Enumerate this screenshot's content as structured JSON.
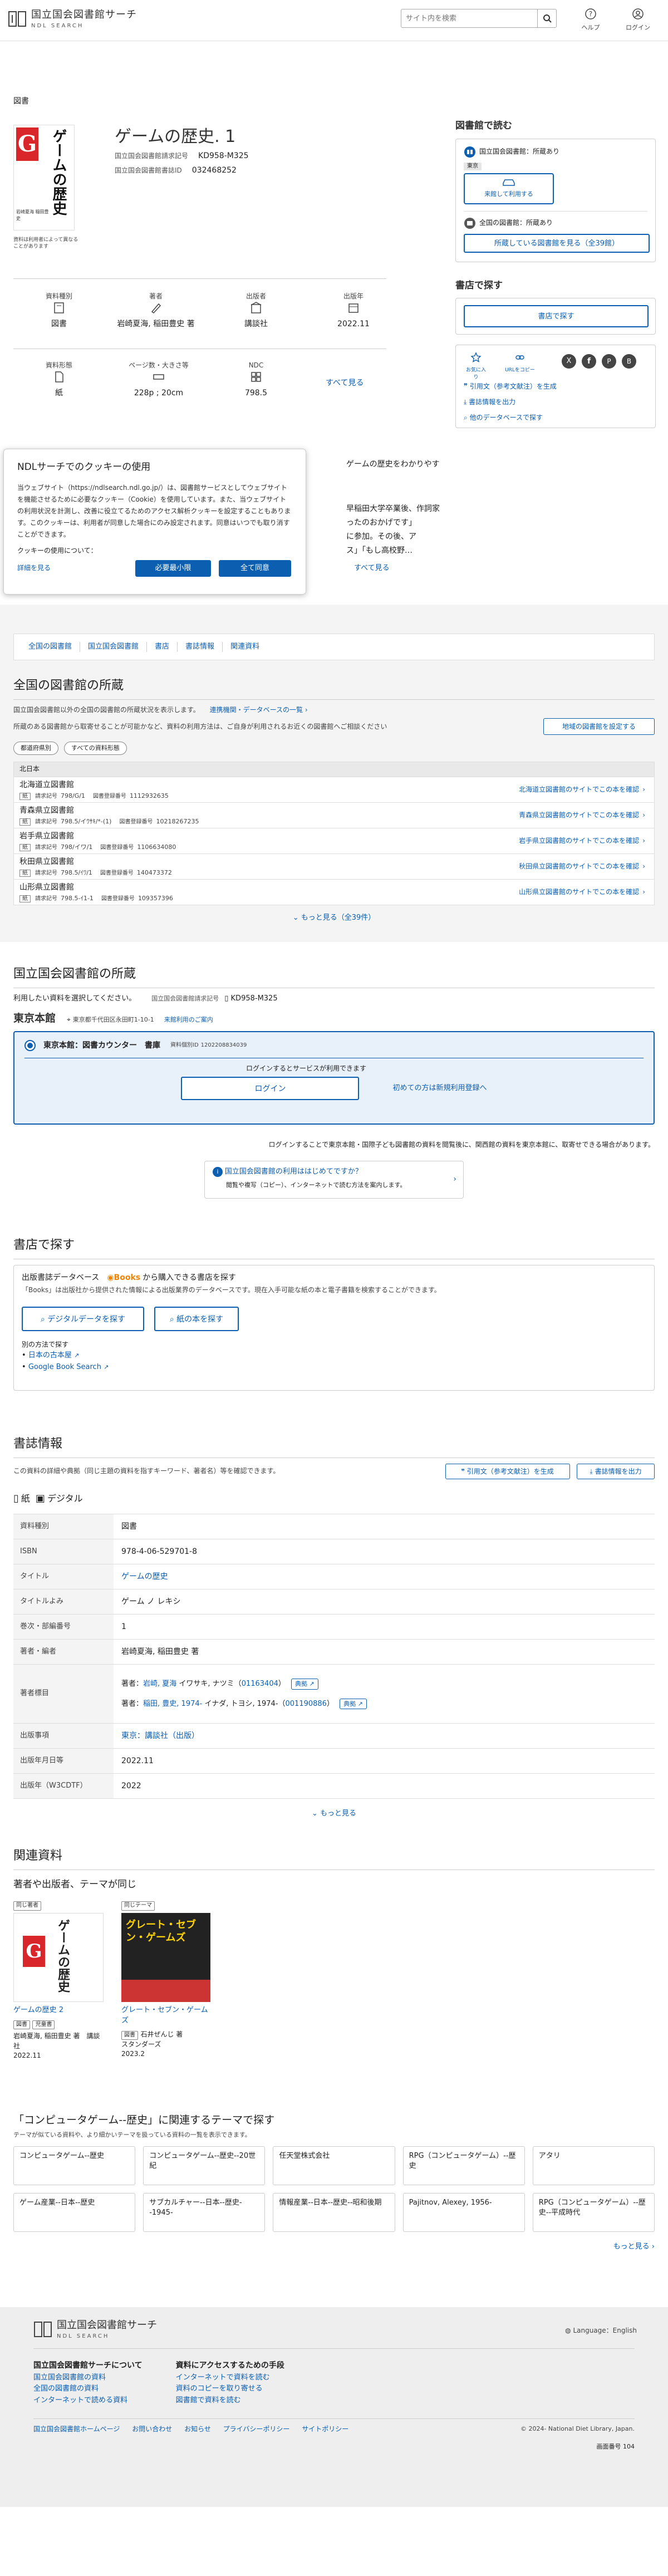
{
  "header": {
    "logo_title": "国立国会図書館サーチ",
    "logo_sub": "NDL SEARCH",
    "search_placeholder": "サイト内を検索",
    "help": "ヘルプ",
    "login": "ログイン"
  },
  "breadcrumb": "図書",
  "book": {
    "title": "ゲームの歴史. 1",
    "call_label": "国立国会図書館請求記号",
    "call_no": "KD958-M325",
    "bib_label": "国立国会図書館書誌ID",
    "bib_no": "032468252",
    "cover_title": "ゲームの歴史",
    "cover_author": "岩崎夏海 稲田豊史",
    "cover_note": "資料は利用者によって異なることがあります"
  },
  "props": [
    {
      "label": "資料種別",
      "value": "図書"
    },
    {
      "label": "著者",
      "value": "岩崎夏海, 稲田豊史 著"
    },
    {
      "label": "出版者",
      "value": "講談社"
    },
    {
      "label": "出版年",
      "value": "2022.11"
    },
    {
      "label": "資料形態",
      "value": "紙"
    },
    {
      "label": "ページ数・大きさ等",
      "value": "228p ; 20cm"
    },
    {
      "label": "NDC",
      "value": "798.5"
    }
  ],
  "see_all": "すべて見る",
  "summary": {
    "l1": "ゲームの歴史をわかりやす",
    "l2": "早稲田大学卒業後、作詞家",
    "l3": "ったのおかげです」",
    "l4": "に参加。その後、ア",
    "l5": "ス」「もし高校野…",
    "more": "すべて見る"
  },
  "cookie": {
    "title": "NDLサーチでのクッキーの使用",
    "body": "当ウェブサイト（https://ndlsearch.ndl.go.jp/）は、図書館サービスとしてウェブサイトを機能させるために必要なクッキー（Cookie）を使用しています。また、当ウェブサイトの利用状況を計測し、改善に役立てるためのアクセス解析クッキーを設定することもあります。このクッキーは、利用者が同意した場合にのみ設定されます。同意はいつでも取り消すことができます。",
    "q": "クッキーの使用について：",
    "detail": "詳細を見る",
    "essential": "必要最小限",
    "accept": "全て同意"
  },
  "side": {
    "read_title": "図書館で読む",
    "ndl_label": "国立国会図書館：所蔵あり",
    "tokyo": "東京",
    "arrive": "来館して利用する",
    "all_label": "全国の図書館：所蔵あり",
    "all_btn": "所蔵している図書館を見る（全39館）",
    "shop_title": "書店で探す",
    "shop_btn": "書店で探す",
    "fav": "お気に入り",
    "url": "URLをコピー",
    "cite": "引用文（参考文献注）を生成",
    "export": "書誌情報を出力",
    "other_db": "他のデータベースで探す"
  },
  "nav": [
    "全国の図書館",
    "国立国会図書館",
    "書店",
    "書誌情報",
    "関連資料"
  ],
  "lib": {
    "title": "全国の図書館の所蔵",
    "desc": "国立国会図書館以外の全国の図書館の所蔵状況を表示します。",
    "link": "連携機関・データベースの一覧",
    "note": "所蔵のある図書館から取寄せることが可能かなど、資料の利用方法は、ご自身が利用されるお近くの図書館へご相談ください",
    "region_btn": "地域の図書館を設定する",
    "f1": "都道府県別",
    "f2": "すべての資料形態",
    "head": "北日本",
    "shelf_label": "請求記号",
    "reg_label": "図書登録番号",
    "paper": "紙",
    "site_link_suffix": "のサイトでこの本を確認",
    "more": "もっと見る（全39件）"
  },
  "libs": [
    {
      "name": "北海道立図書館",
      "call": "798/G/1",
      "reg": "1112932635",
      "site": "北海道立図書館"
    },
    {
      "name": "青森県立図書館",
      "call": "798.5/イﾜｻｷ/*-(1)",
      "reg": "10218267235",
      "site": "青森県立図書館"
    },
    {
      "name": "岩手県立図書館",
      "call": "798/イワ/1",
      "reg": "1106634080",
      "site": "岩手県立図書館"
    },
    {
      "name": "秋田県立図書館",
      "call": "798.5/ｲﾜ/1",
      "reg": "140473372",
      "site": "秋田県立図書館"
    },
    {
      "name": "山形県立図書館",
      "call": "798.5-ｲ1-1",
      "reg": "109357396",
      "site": "山形県立図書館"
    }
  ],
  "ndl": {
    "title": "国立国会図書館の所蔵",
    "use": "利用したい資料を選択してください。",
    "call_label": "国立国会図書館請求記号",
    "call": "KD958-M325",
    "tokyo": "東京本館",
    "addr": "東京都千代田区永田町1-10-1",
    "guide": "来館利用のご案内",
    "counter": "東京本館：図書カウンター　書庫",
    "id_label": "資料個別ID",
    "id": "1202208834039",
    "login_need": "ログインするとサービスが利用できます",
    "login": "ログイン",
    "register": "初めての方は新規利用登録へ",
    "login_note": "ログインすることで東京本館・国際子ども図書館の資料を閲覧後に、関西館の資料を東京本館に、取寄せできる場合があります。",
    "first_title": "国立国会図書館の利用ははじめてですか？",
    "first_desc": "閲覧や複写（コピー）、インターネットで読む方法を案内します。"
  },
  "store": {
    "title": "書店で探す",
    "db": "出版書誌データベース",
    "books": "Books",
    "db2": "から購入できる書店を探す",
    "desc": "「Books」は出版社から提供された情報による出版業界のデータベースです。現在入手可能な紙の本と電子書籍を検索することができます。",
    "digital": "デジタルデータを探す",
    "paper": "紙の本を探す",
    "other": "別の方法で探す",
    "amazon": "日本の古本屋",
    "google": "Google Book Search"
  },
  "biblio": {
    "title": "書誌情報",
    "desc": "この資料の詳細や典拠（同じ主題の資料を指すキーワード、著者名）等を確認できます。",
    "cite": "引用文（参考文献注）を生成",
    "export": "書誌情報を出力",
    "paper": "紙",
    "digital": "デジタル",
    "more": "もっと見る"
  },
  "rows": [
    {
      "k": "資料種別",
      "v": "図書",
      "link": false
    },
    {
      "k": "ISBN",
      "v": "978-4-06-529701-8",
      "link": false
    },
    {
      "k": "タイトル",
      "v": "ゲームの歴史",
      "link": true
    },
    {
      "k": "タイトルよみ",
      "v": "ゲーム ノ レキシ",
      "link": false
    },
    {
      "k": "巻次・部編番号",
      "v": "1",
      "link": false
    },
    {
      "k": "著者・編者",
      "v": "岩崎夏海, 稲田豊史 著",
      "link": false
    }
  ],
  "authors": {
    "k": "著者標目",
    "a1_pre": "著者：",
    "a1_link": "岩崎, 夏海",
    "a1_mid": " イワサキ, ナツミ（",
    "a1_id": "01163404",
    "a1_end": "）",
    "a2_pre": "著者：",
    "a2_link": "稲田, 豊史, 1974-",
    "a2_mid": " イナダ, トヨシ, 1974-（",
    "a2_id": "001190886",
    "a2_end": "）",
    "src": "典拠"
  },
  "rows2": [
    {
      "k": "出版事項",
      "v": "東京：講談社（出版）",
      "link": true
    },
    {
      "k": "出版年月日等",
      "v": "2022.11",
      "link": false
    },
    {
      "k": "出版年（W3CDTF）",
      "v": "2022",
      "link": false
    }
  ],
  "related": {
    "title": "関連資料",
    "sub": "著者や出版者、テーマが同じ",
    "b1_tag": "同じ著者",
    "b1_title": "ゲームの歴史 2",
    "b1_t1": "図書",
    "b1_t2": "児童書",
    "b1_auth": "岩崎夏海, 稲田豊史 著　講談社",
    "b1_year": "2022.11",
    "b2_tag": "同じテーマ",
    "b2_title": "グレート・セブン・ゲームズ",
    "b2_t1": "図書",
    "b2_auth": "石井ぜんじ 著",
    "b2_pub": "スタンダーズ",
    "b2_year": "2023.2",
    "b2_cover": "グレート・セブン・ゲームズ"
  },
  "theme": {
    "title": "「コンピュータゲーム--歴史」に関連するテーマで探す",
    "sub": "テーマが似ている資料や、より細かいテーマを扱っている資料の一覧を表示できます。",
    "more": "もっと見る"
  },
  "themes": [
    "コンピュータゲーム--歴史",
    "コンピュータゲーム--歴史--20世紀",
    "任天堂株式会社",
    "RPG（コンピュータゲーム）--歴史",
    "アタリ",
    "ゲーム産業--日本--歴史",
    "サブカルチャー--日本--歴史--1945-",
    "情報産業--日本--歴史--昭和後期",
    "Pajitnov, Alexey, 1956-",
    "RPG（コンピュータゲーム）--歴史--平成時代"
  ],
  "footer": {
    "logo_title": "国立国会図書館サーチ",
    "logo_sub": "NDL SEARCH",
    "lang": "Language：English",
    "c1": "国立国会図書館サーチについて",
    "c1a": "国立国会図書館の資料",
    "c1b": "全国の図書館の資料",
    "c1c": "インターネットで読める資料",
    "c2": "資料にアクセスするための手段",
    "c2a": "インターネットで資料を読む",
    "c2b": "資料のコピーを取り寄せる",
    "c2c": "図書館で資料を読む",
    "f1": "国立国会図書館ホームページ",
    "f2": "お問い合わせ",
    "f3": "お知らせ",
    "f4": "プライバシーポリシー",
    "f5": "サイトポリシー",
    "copy": "© 2024- National Diet Library, Japan.",
    "no_label": "画面番号",
    "no": "104"
  }
}
